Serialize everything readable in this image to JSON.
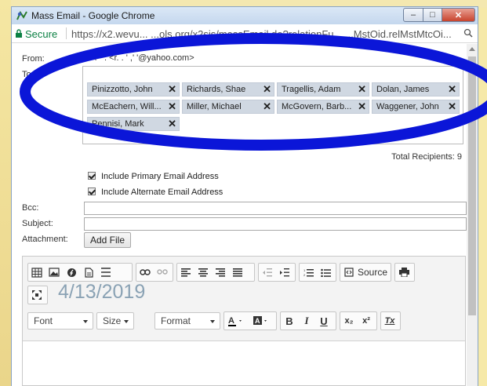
{
  "window": {
    "title": "Mass Email - Google Chrome",
    "min_label": "–",
    "max_label": "□",
    "close_label": "✕"
  },
  "address_bar": {
    "secure_label": "Secure",
    "url": "https://x2.wevu...  ...ols.org/x2sis/massEmail.do?relationFu...  ...MstOid.relMstMtcOi..."
  },
  "form": {
    "from_label": "From:",
    "from_value": "A'      '\\'     '  .  <r.           .  '  ,' '@yahoo.com>",
    "to_label": "To:",
    "recipients": [
      "Pinizzotto, John",
      "Richards, Shae",
      "Tragellis, Adam",
      "Dolan, James",
      "McEachern, Will...",
      "Miller, Michael",
      "McGovern, Barb...",
      "Waggener, John",
      "Pennisi, Mark"
    ],
    "remove_glyph": "✕",
    "total_recipients": "Total Recipients: 9",
    "include_primary": "Include Primary Email Address",
    "include_alternate": "Include Alternate Email Address",
    "bcc_label": "Bcc:",
    "subject_label": "Subject:",
    "attachment_label": "Attachment:",
    "add_file_label": "Add File"
  },
  "editor": {
    "source_label": "Source",
    "font_label": "Font",
    "size_label": "Size",
    "format_label": "Format",
    "bold": "B",
    "italic": "I",
    "underline": "U",
    "subscript": "x₂",
    "superscript": "x²",
    "clear_format": "Tx"
  },
  "overlay": {
    "date_stamp": "4/13/2019",
    "ring_color": "#0b16d8"
  }
}
